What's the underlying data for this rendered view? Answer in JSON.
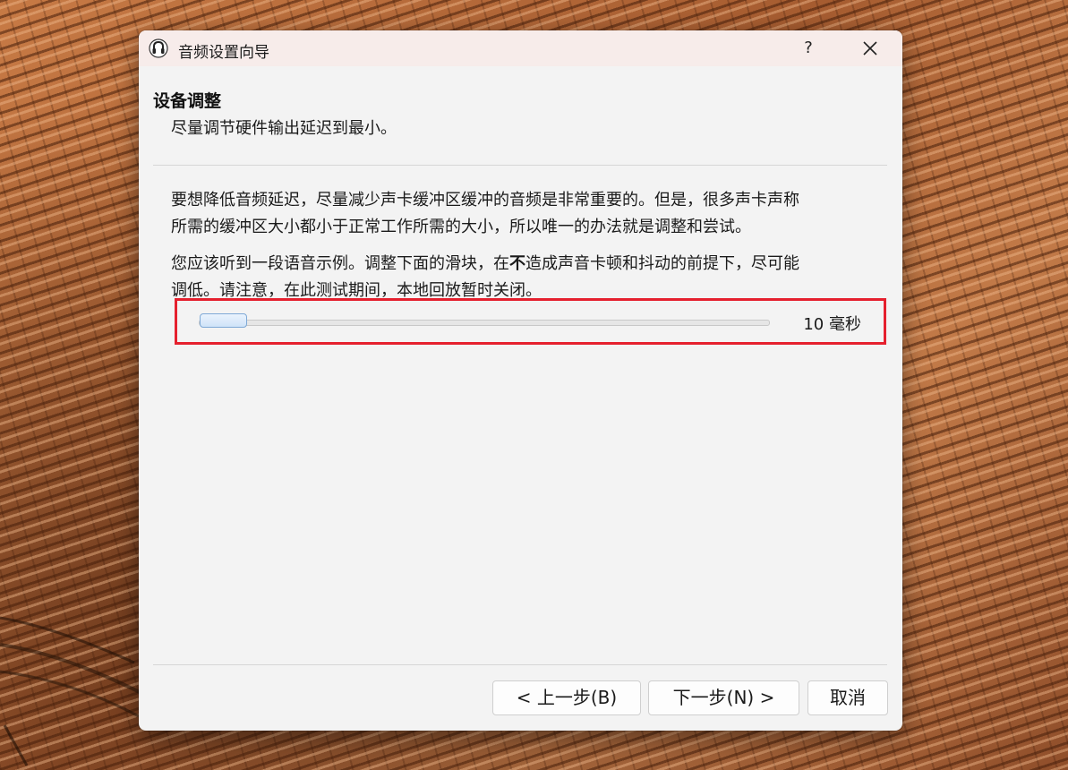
{
  "window": {
    "title": "音频设置向导",
    "help_label": "?"
  },
  "header": {
    "title": "设备调整",
    "subtitle": "尽量调节硬件输出延迟到最小。"
  },
  "body": {
    "para1_line1": "要想降低音频延迟，尽量减少声卡缓冲区缓冲的音频是非常重要的。但是，很多声卡声称",
    "para1_line2": "所需的缓冲区大小都小于正常工作所需的大小，所以唯一的办法就是调整和尝试。",
    "para2_line1_pre": "您应该听到一段语音示例。调整下面的滑块，在",
    "para2_line1_bold": "不",
    "para2_line1_post": "造成声音卡顿和抖动的前提下，尽可能",
    "para2_line2": "调低。请注意，在此测试期间，本地回放暂时关闭。"
  },
  "slider": {
    "value_label": "10 毫秒",
    "position_fraction": 0.0
  },
  "buttons": {
    "back": "< 上一步(B)",
    "next": "下一步(N) >",
    "cancel": "取消"
  },
  "colors": {
    "highlight_border": "#e5202e",
    "titlebar_bg": "#f7ecea",
    "dialog_bg": "#f3f3f3",
    "slider_handle": "#cfe3f8"
  },
  "icons": {
    "app": "headset-icon",
    "close": "close-icon"
  }
}
